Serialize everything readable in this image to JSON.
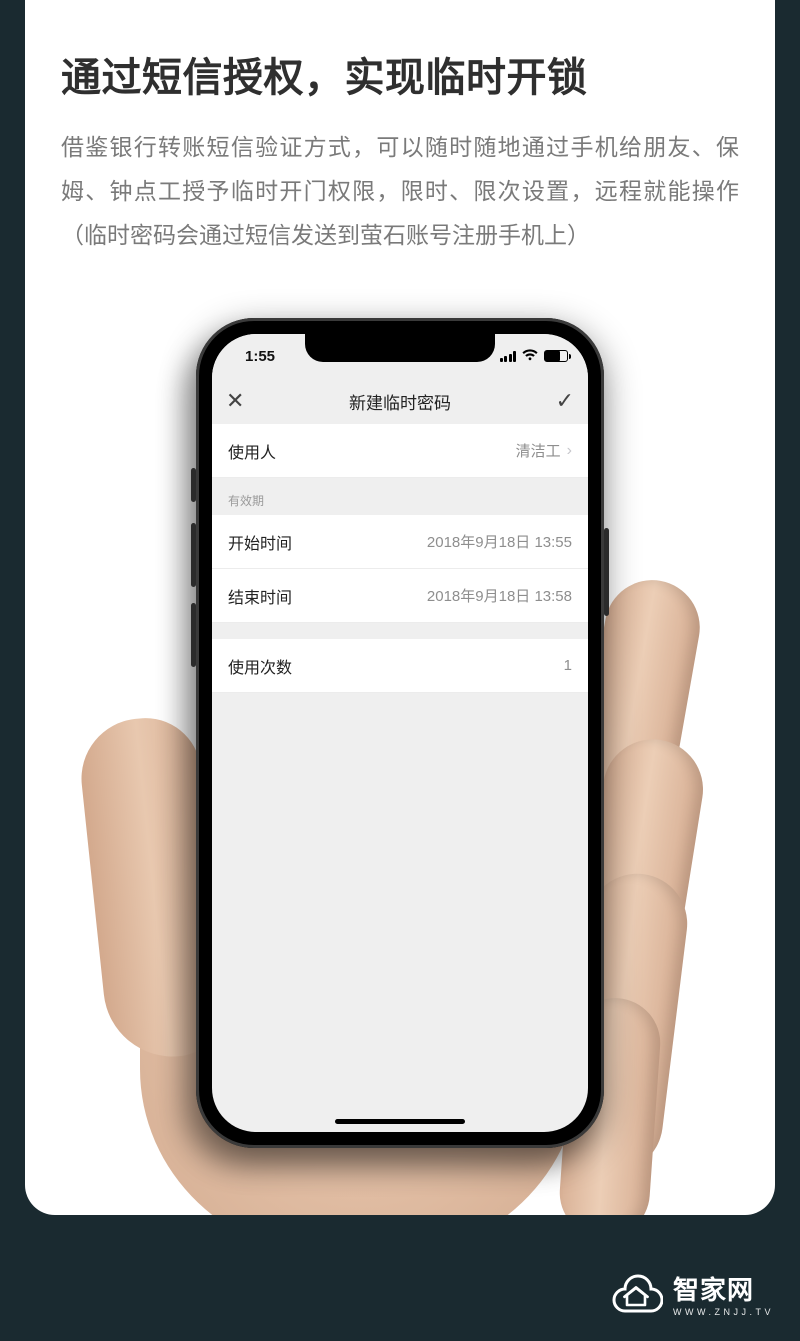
{
  "header": {
    "title": "通过短信授权，实现临时开锁",
    "description": "借鉴银行转账短信验证方式，可以随时随地通过手机给朋友、保姆、钟点工授予临时开门权限，限时、限次设置，远程就能操作（临时密码会通过短信发送到萤石账号注册手机上）"
  },
  "phone": {
    "statusbar": {
      "time": "1:55"
    },
    "navbar": {
      "title": "新建临时密码"
    },
    "rows": {
      "user": {
        "label": "使用人",
        "value": "清洁工"
      },
      "sectionLbl": "有效期",
      "start": {
        "label": "开始时间",
        "value": "2018年9月18日 13:55"
      },
      "end": {
        "label": "结束时间",
        "value": "2018年9月18日 13:58"
      },
      "count": {
        "label": "使用次数",
        "value": "1"
      }
    }
  },
  "watermark": {
    "name_cn": "智家网",
    "url": "WWW.ZNJJ.TV"
  }
}
